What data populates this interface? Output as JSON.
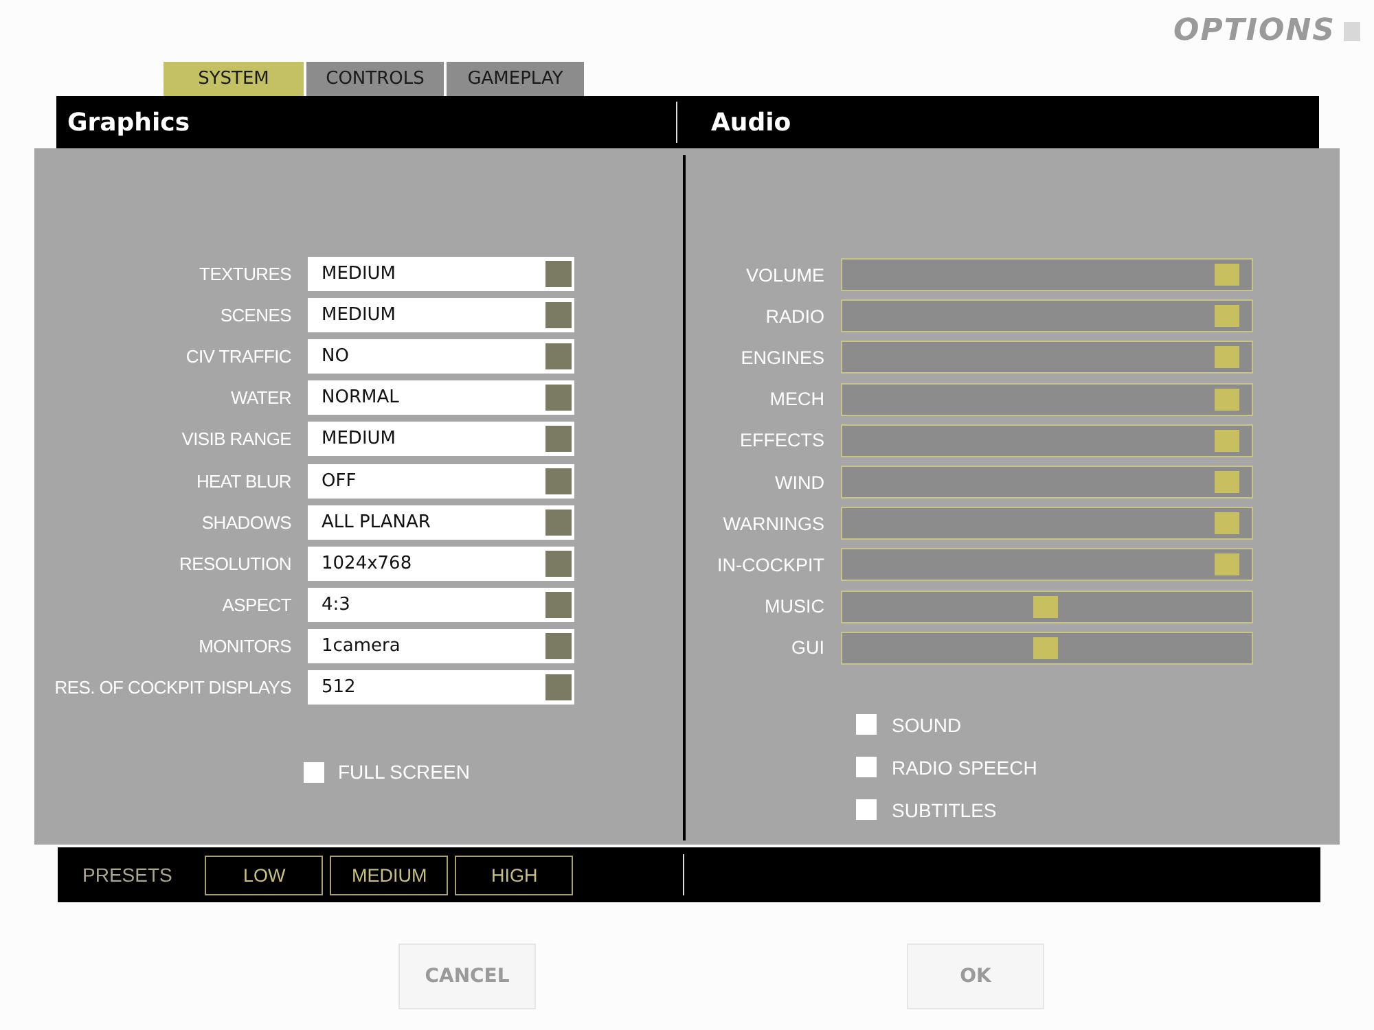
{
  "title": "OPTIONS",
  "tabs": [
    {
      "label": "SYSTEM",
      "selected": true
    },
    {
      "label": "CONTROLS",
      "selected": false
    },
    {
      "label": "GAMEPLAY",
      "selected": false
    }
  ],
  "graphics": {
    "title": "Graphics",
    "settings": [
      {
        "label": "TEXTURES",
        "value": "MEDIUM"
      },
      {
        "label": "SCENES",
        "value": "MEDIUM"
      },
      {
        "label": "CIV TRAFFIC",
        "value": "NO"
      },
      {
        "label": "WATER",
        "value": "NORMAL"
      },
      {
        "label": "VISIB RANGE",
        "value": "MEDIUM"
      },
      {
        "label": "HEAT BLUR",
        "value": "OFF"
      },
      {
        "label": "SHADOWS",
        "value": "ALL PLANAR"
      },
      {
        "label": "RESOLUTION",
        "value": "1024x768"
      },
      {
        "label": "ASPECT",
        "value": "4:3"
      },
      {
        "label": "MONITORS",
        "value": "1camera"
      },
      {
        "label": "RES. OF COCKPIT DISPLAYS",
        "value": "512"
      }
    ],
    "full_screen": {
      "label": "FULL SCREEN",
      "checked": false
    }
  },
  "audio": {
    "title": "Audio",
    "sliders": [
      {
        "label": "VOLUME",
        "level": 0.98
      },
      {
        "label": "RADIO",
        "level": 0.98
      },
      {
        "label": "ENGINES",
        "level": 0.98
      },
      {
        "label": "MECH",
        "level": 0.98
      },
      {
        "label": "EFFECTS",
        "level": 0.98
      },
      {
        "label": "WIND",
        "level": 0.98
      },
      {
        "label": "WARNINGS",
        "level": 0.98
      },
      {
        "label": "IN-COCKPIT",
        "level": 0.98
      },
      {
        "label": "MUSIC",
        "level": 0.5
      },
      {
        "label": "GUI",
        "level": 0.5
      }
    ],
    "checkboxes": [
      {
        "label": "SOUND",
        "checked": false
      },
      {
        "label": "RADIO SPEECH",
        "checked": false
      },
      {
        "label": "SUBTITLES",
        "checked": false
      }
    ]
  },
  "presets": {
    "label": "PRESETS",
    "buttons": [
      "LOW",
      "MEDIUM",
      "HIGH"
    ]
  },
  "buttons": [
    "CANCEL",
    "OK"
  ]
}
